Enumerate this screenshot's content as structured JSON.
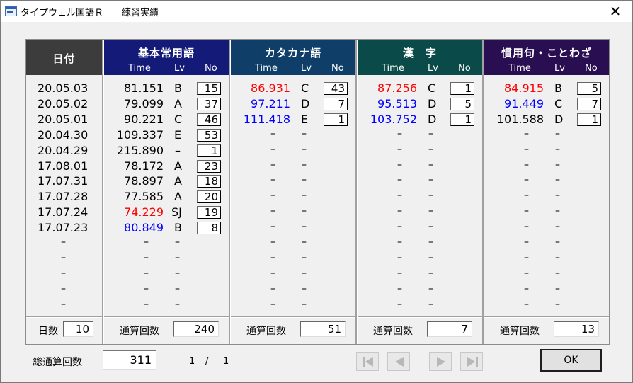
{
  "window": {
    "title": "タイプウェル国語Ｒ　　練習実績",
    "close": "✕"
  },
  "colors": {
    "red": "#ff0000",
    "blue": "#0000ff",
    "black": "#000000",
    "hdr_date": "#3c3c3c",
    "hdr_kihon": "#141a78",
    "hdr_kata": "#0f3f68",
    "hdr_kanji": "#0a4a48",
    "hdr_kanyo": "#2a0e52"
  },
  "date_column": {
    "header": "日付",
    "dates": [
      "20.05.03",
      "20.05.02",
      "20.05.01",
      "20.04.30",
      "20.04.29",
      "17.08.01",
      "17.07.31",
      "17.07.28",
      "17.07.24",
      "17.07.23",
      "–",
      "–",
      "–",
      "–",
      "–"
    ],
    "footer_label": "日数",
    "footer_value": "10"
  },
  "sub_headers": {
    "time": "Time",
    "lv": "Lv",
    "no": "No"
  },
  "footer_label_common": "通算回数",
  "sections": [
    {
      "title": "基本常用語",
      "total": "240",
      "rows": [
        {
          "time": "81.151",
          "lv": "B",
          "no": "15",
          "color": "black"
        },
        {
          "time": "79.099",
          "lv": "A",
          "no": "37",
          "color": "black"
        },
        {
          "time": "90.221",
          "lv": "C",
          "no": "46",
          "color": "black"
        },
        {
          "time": "109.337",
          "lv": "E",
          "no": "53",
          "color": "black"
        },
        {
          "time": "215.890",
          "lv": "–",
          "no": "1",
          "color": "black"
        },
        {
          "time": "78.172",
          "lv": "A",
          "no": "23",
          "color": "black"
        },
        {
          "time": "78.897",
          "lv": "A",
          "no": "18",
          "color": "black"
        },
        {
          "time": "77.585",
          "lv": "A",
          "no": "20",
          "color": "black"
        },
        {
          "time": "74.229",
          "lv": "SJ",
          "no": "19",
          "color": "red"
        },
        {
          "time": "80.849",
          "lv": "B",
          "no": "8",
          "color": "blue"
        }
      ]
    },
    {
      "title": "カタカナ語",
      "total": "51",
      "rows": [
        {
          "time": "86.931",
          "lv": "C",
          "no": "43",
          "color": "red"
        },
        {
          "time": "97.211",
          "lv": "D",
          "no": "7",
          "color": "blue"
        },
        {
          "time": "111.418",
          "lv": "E",
          "no": "1",
          "color": "blue"
        }
      ]
    },
    {
      "title": "漢　字",
      "total": "7",
      "rows": [
        {
          "time": "87.256",
          "lv": "C",
          "no": "1",
          "color": "red"
        },
        {
          "time": "95.513",
          "lv": "D",
          "no": "5",
          "color": "blue"
        },
        {
          "time": "103.752",
          "lv": "D",
          "no": "1",
          "color": "blue"
        }
      ]
    },
    {
      "title": "慣用句・ことわざ",
      "total": "13",
      "rows": [
        {
          "time": "84.915",
          "lv": "B",
          "no": "5",
          "color": "red"
        },
        {
          "time": "91.449",
          "lv": "C",
          "no": "7",
          "color": "blue"
        },
        {
          "time": "101.588",
          "lv": "D",
          "no": "1",
          "color": "black"
        }
      ]
    }
  ],
  "empty_mark": "–",
  "bottom": {
    "total_label": "総通算回数",
    "total_value": "311",
    "page_current": "1",
    "page_sep": "/",
    "page_total": "1",
    "ok_label": "OK"
  },
  "nav_icons": [
    "first-page-icon",
    "prev-page-icon",
    "next-page-icon",
    "last-page-icon"
  ]
}
